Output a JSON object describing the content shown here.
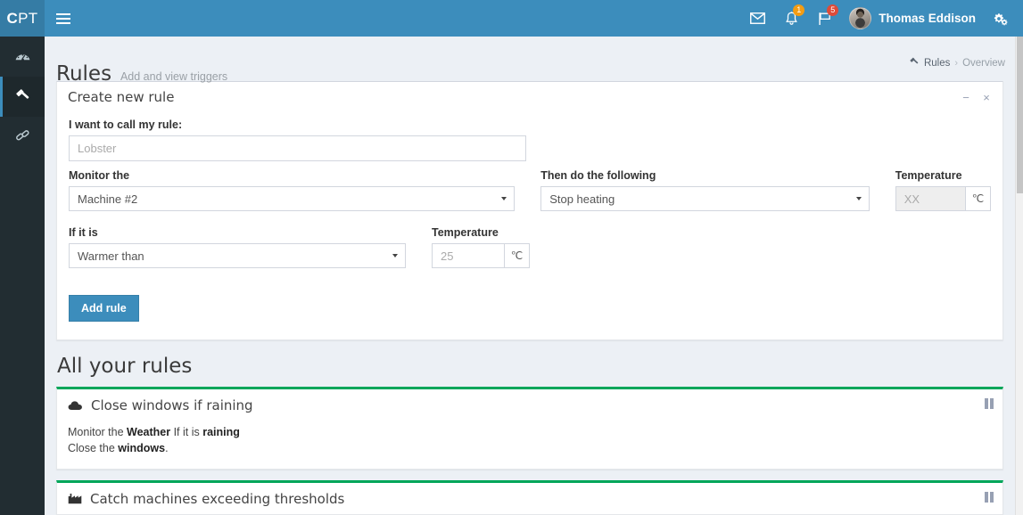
{
  "header": {
    "logo_c": "C",
    "logo_rest": "PT",
    "menu_toggle_label": "≡",
    "icons": {
      "messages": "envelope-icon",
      "notifications": "bell-icon",
      "tasks": "flag-icon",
      "settings": "gears-icon"
    },
    "notifications_badge": "1",
    "tasks_badge": "5",
    "user_name": "Thomas Eddison",
    "accent_color": "#3c8dbc",
    "logo_color": "#357ca5",
    "badge_warning_color": "#f39c12",
    "badge_danger_color": "#dd4b39"
  },
  "sidebar": {
    "items": [
      {
        "name": "dashboard",
        "icon": "tachometer-icon",
        "active": false
      },
      {
        "name": "rules",
        "icon": "gavel-icon",
        "active": true
      },
      {
        "name": "links",
        "icon": "chain-icon",
        "active": false
      }
    ]
  },
  "page": {
    "title": "Rules",
    "subtitle": "Add and view triggers",
    "breadcrumb": {
      "icon": "gavel-icon",
      "root": "Rules",
      "separator": "›",
      "current": "Overview"
    }
  },
  "create_rule": {
    "box_title": "Create new rule",
    "tools": {
      "collapse": "−",
      "close": "×"
    },
    "name_label": "I want to call my rule:",
    "name_value": "",
    "name_placeholder": "Lobster",
    "monitor_label": "Monitor the",
    "monitor_value": "Machine #2",
    "then_label": "Then do the following",
    "then_value": "Stop heating",
    "action_temp_label": "Temperature",
    "action_temp_value": "",
    "action_temp_placeholder": "XX",
    "action_temp_unit": "℃",
    "condition_label": "If it is",
    "condition_value": "Warmer than",
    "condition_temp_label": "Temperature",
    "condition_temp_value": "",
    "condition_temp_placeholder": "25",
    "condition_temp_unit": "℃",
    "submit_label": "Add rule"
  },
  "rules_section": {
    "title": "All your rules",
    "accent_color": "#00a65a",
    "rules": [
      {
        "icon": "cloud-icon",
        "title": "Close windows if raining",
        "line1_prefix": "Monitor the ",
        "line1_subject": "Weather",
        "line1_middle": " If it is ",
        "line1_condition": "raining",
        "line2_prefix": "Close the ",
        "line2_object": "windows",
        "line2_suffix": ".",
        "toggle": "pause-icon"
      },
      {
        "icon": "factory-icon",
        "title": "Catch machines exceeding thresholds",
        "toggle": "pause-icon"
      }
    ]
  }
}
